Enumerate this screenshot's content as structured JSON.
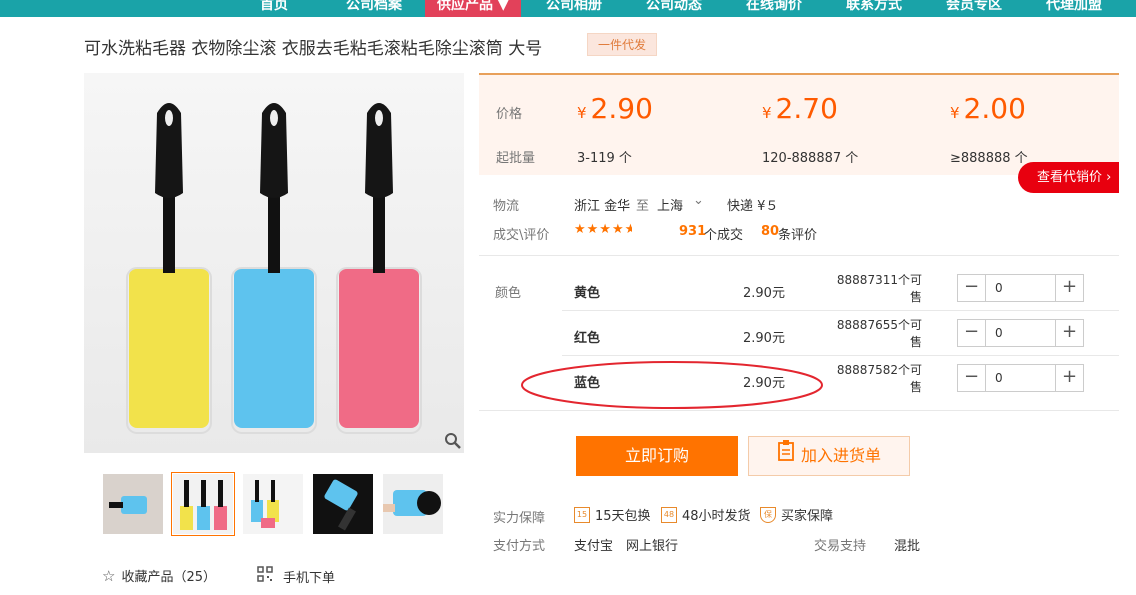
{
  "nav": [
    "首页",
    "公司档案",
    "供应产品 ▼",
    "公司相册",
    "公司动态",
    "在线询价",
    "联系方式",
    "会员专区",
    "代理加盟"
  ],
  "product": {
    "title": "可水洗粘毛器 衣物除尘滚 衣服去毛粘毛滚粘毛除尘滚筒 大号",
    "badge": "一件代发"
  },
  "prices": {
    "price_label": "价格",
    "moq_label": "起批量",
    "currency": "¥",
    "tiers": [
      {
        "price": "2.90",
        "qty": "3-119 个"
      },
      {
        "price": "2.70",
        "qty": "120-888887 个"
      },
      {
        "price": "2.00",
        "qty": "≥888888 个"
      }
    ],
    "agent_button": "查看代销价"
  },
  "logistics": {
    "label": "物流",
    "from": "浙江 金华",
    "to_word": "至",
    "to": "上海",
    "shipping": "快递 ¥５"
  },
  "deals": {
    "label": "成交\\评价",
    "rating": 4.5,
    "count": "931",
    "count_suffix": "个成交",
    "reviews": "80",
    "reviews_suffix": "条评价"
  },
  "sku": {
    "label": "颜色",
    "items": [
      {
        "name": "黄色",
        "price": "2.90元",
        "stock": "88887311个可售",
        "qty": "0"
      },
      {
        "name": "红色",
        "price": "2.90元",
        "stock": "88887655个可售",
        "qty": "0"
      },
      {
        "name": "蓝色",
        "price": "2.90元",
        "stock": "88887582个可售",
        "qty": "0"
      }
    ]
  },
  "actions": {
    "buy": "立即订购",
    "cart": "加入进货单"
  },
  "guarantee": {
    "label": "实力保障",
    "items": [
      "15天包换",
      "48小时发货",
      "买家保障"
    ],
    "icons": [
      "15",
      "48",
      "保"
    ]
  },
  "payment": {
    "label": "支付方式",
    "methods": "支付宝　网上银行",
    "trade_label": "交易支持",
    "trade_value": "混批"
  },
  "gallery": {
    "favorite": "收藏产品（25）",
    "mobile": "手机下单"
  },
  "colors": {
    "accent": "#ff7300",
    "nav_bg": "#1aa3a8",
    "nav_active": "#e2415a",
    "highlight_circle": "#e3262f"
  }
}
